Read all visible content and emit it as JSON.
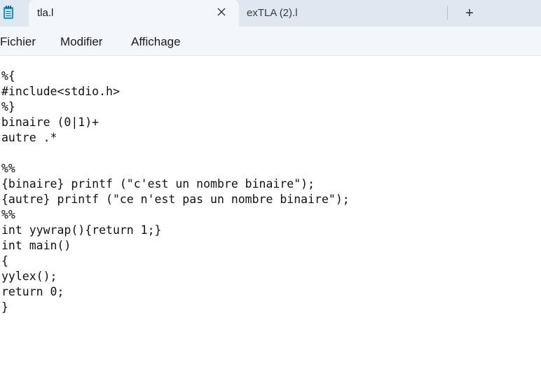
{
  "tabs": [
    {
      "label": "tla.l",
      "active": true
    },
    {
      "label": "exTLA (2).l",
      "active": false
    }
  ],
  "new_tab_symbol": "+",
  "menu": [
    "Fichier",
    "Modifier",
    "Affichage"
  ],
  "editor": {
    "lines": [
      "",
      "%{",
      "#include<stdio.h>",
      "%}",
      "binaire (0|1)+",
      "autre .*",
      "",
      "%%",
      "{binaire} printf (\"c'est un nombre binaire\");",
      "{autre} printf (\"ce n'est pas un nombre binaire\");",
      "%%",
      "int yywrap(){return 1;}",
      "int main()",
      "{",
      "yylex();",
      "return 0;",
      "}"
    ]
  },
  "icons": {
    "app": "notepad-icon",
    "close": "close-icon",
    "add": "plus-icon"
  },
  "colors": {
    "tabbar": "#dfe7f1",
    "active_tab": "#f3f6fa",
    "notepad_icon": "#1f8fd6"
  }
}
